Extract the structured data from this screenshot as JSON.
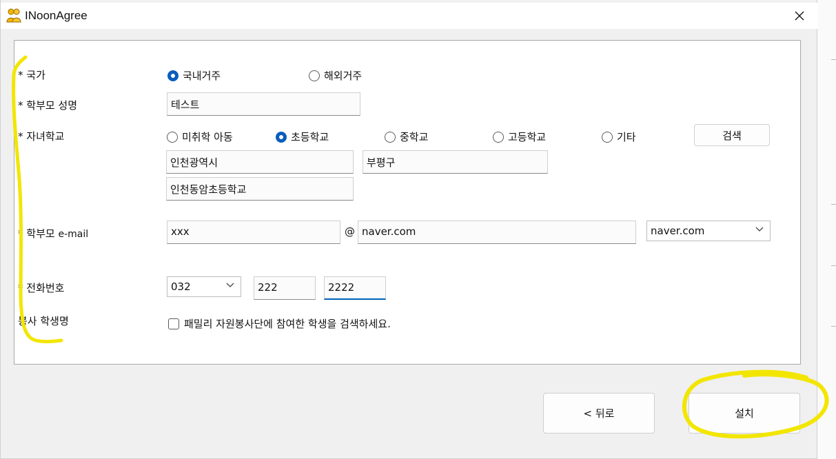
{
  "window": {
    "title": "INoonAgree"
  },
  "colors": {
    "accent": "#0a5dbd",
    "annotation": "#f2e600"
  },
  "form": {
    "country": {
      "label": "* 국가",
      "options": [
        "국내거주",
        "해외거주"
      ],
      "selected": "국내거주"
    },
    "parent_name": {
      "label": "* 학부모 성명",
      "value": "테스트"
    },
    "school": {
      "label": "* 자녀학교",
      "options": [
        "미취학 아동",
        "초등학교",
        "중학교",
        "고등학교",
        "기타"
      ],
      "selected": "초등학교",
      "search_label": "검색",
      "city": "인천광역시",
      "district": "부평구",
      "school_name": "인천동암초등학교"
    },
    "email": {
      "label_prefix": "* 학부모",
      "label_suffix": "e-mail",
      "local_part": "xxx",
      "at": "@",
      "domain": "naver.com",
      "domain_select": "naver.com"
    },
    "phone": {
      "label": "* 전화번호",
      "area_code": "032",
      "middle": "222",
      "last": "2222"
    },
    "volunteer": {
      "label": "봉사 학생명",
      "checkbox_label": "패밀리 자원봉사단에 참여한 학생을 검색하세요.",
      "checked": false
    }
  },
  "footer": {
    "back_label": "< 뒤로",
    "install_label": "설치"
  }
}
